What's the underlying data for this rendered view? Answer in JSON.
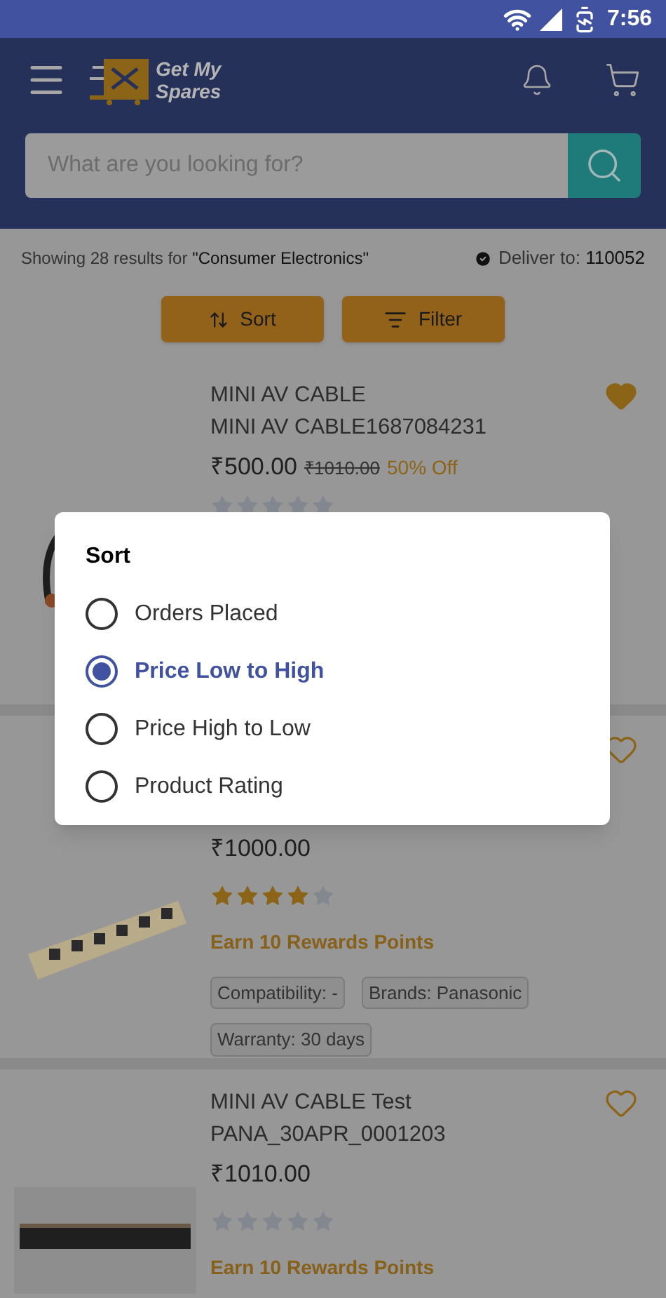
{
  "status_bar": {
    "time": "7:56"
  },
  "header": {
    "logo_lines": [
      "Get My",
      "Spares"
    ]
  },
  "search": {
    "placeholder": "What are you looking for?"
  },
  "results": {
    "text": "Showing 28 results for ",
    "query": "\"Consumer Electronics\"",
    "deliver_label": "Deliver to: ",
    "pincode": "110052"
  },
  "actions": [
    {
      "kind": "sort",
      "label": "Sort"
    },
    {
      "kind": "filter",
      "label": "Filter"
    }
  ],
  "products": [
    {
      "title_lines": [
        "MINI AV CABLE",
        "MINI AV CABLE1687084231"
      ],
      "price": "₹500.00",
      "old_price": "₹1010.00",
      "discount": "50% Off",
      "stars": 0,
      "favorite": true
    },
    {
      "price": "₹1000.00",
      "stars": 4,
      "favorite": false,
      "rewards": "Earn 10 Rewards Points",
      "tags": [
        "Compatibility: -",
        "Brands: Panasonic",
        "Warranty: 30 days"
      ]
    },
    {
      "title_lines": [
        "MINI AV CABLE Test",
        "PANA_30APR_0001203"
      ],
      "price": "₹1010.00",
      "stars": 0,
      "favorite": false,
      "rewards": "Earn 10 Rewards Points"
    }
  ],
  "sort_dialog": {
    "title": "Sort",
    "options": [
      {
        "label": "Orders Placed",
        "selected": false
      },
      {
        "label": "Price Low to High",
        "selected": true
      },
      {
        "label": "Price High to Low",
        "selected": false
      },
      {
        "label": "Product Rating",
        "selected": false
      }
    ]
  }
}
